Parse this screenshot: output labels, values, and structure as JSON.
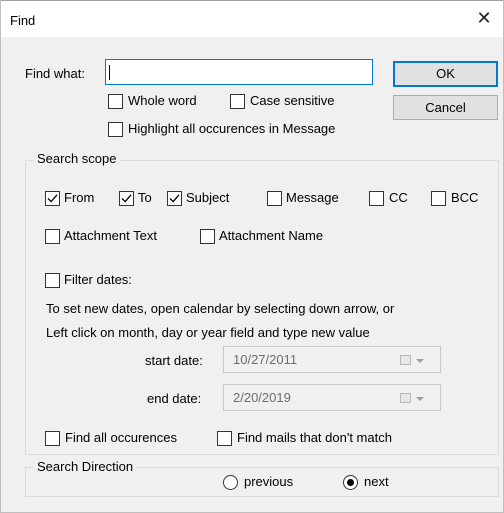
{
  "window": {
    "title": "Find",
    "close_glyph": "✕"
  },
  "find": {
    "label": "Find what:",
    "value": "",
    "ok_label": "OK",
    "cancel_label": "Cancel",
    "whole_word": {
      "label": "Whole word",
      "checked": false
    },
    "case_sensitive": {
      "label": "Case sensitive",
      "checked": false
    },
    "highlight_all": {
      "label": "Highlight all occurences in Message",
      "checked": false
    }
  },
  "search_scope": {
    "title": "Search scope",
    "fields": [
      {
        "label": "From",
        "checked": true
      },
      {
        "label": "To",
        "checked": true
      },
      {
        "label": "Subject",
        "checked": true
      },
      {
        "label": "Message",
        "checked": false
      },
      {
        "label": "CC",
        "checked": false
      },
      {
        "label": "BCC",
        "checked": false
      },
      {
        "label": "Attachment Text",
        "checked": false
      },
      {
        "label": "Attachment Name",
        "checked": false
      }
    ],
    "filter_dates": {
      "label": "Filter dates:",
      "checked": false
    },
    "hint_line1": "To set new dates, open calendar by selecting down arrow, or",
    "hint_line2": "Left click on month, day or year field and type new value",
    "start_date": {
      "label": "start date:",
      "value": "10/27/2011"
    },
    "end_date": {
      "label": "end date:",
      "value": "2/20/2019"
    },
    "find_all": {
      "label": "Find all occurences",
      "checked": false
    },
    "no_match": {
      "label": "Find mails that don't match",
      "checked": false
    }
  },
  "search_direction": {
    "title": "Search Direction",
    "options": [
      {
        "label": "previous",
        "selected": false
      },
      {
        "label": "next",
        "selected": true
      }
    ]
  },
  "colors": {
    "accent": "#0078d7",
    "dialog_bg": "#f0f0f0",
    "button_bg": "#e1e1e1"
  }
}
